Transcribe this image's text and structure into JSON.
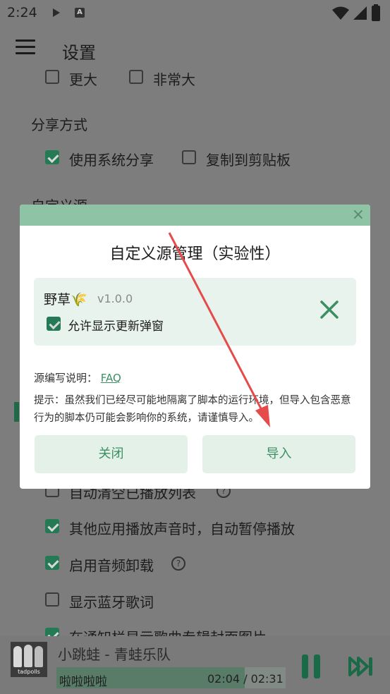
{
  "status_bar": {
    "time": "2:24"
  },
  "app_bar": {
    "title": "设置"
  },
  "settings": {
    "font_size_options": [
      {
        "label": "更大",
        "checked": false
      },
      {
        "label": "非常大",
        "checked": false
      }
    ],
    "share_section": {
      "title": "分享方式"
    },
    "share_options": [
      {
        "label": "使用系统分享",
        "checked": true
      },
      {
        "label": "复制到剪贴板",
        "checked": false
      }
    ],
    "custom_source_section": {
      "title": "自定义源"
    },
    "playback_options": [
      {
        "label": "自动清空已播放列表",
        "checked": false,
        "help": "?"
      },
      {
        "label": "其他应用播放声音时，自动暂停播放",
        "checked": true
      },
      {
        "label": "启用音频卸载",
        "checked": true,
        "help": "?"
      },
      {
        "label": "显示蓝牙歌词",
        "checked": false
      },
      {
        "label": "在通知栏显示歌曲专辑封面图片",
        "checked": true
      }
    ]
  },
  "dialog": {
    "close_glyph": "×",
    "title": "自定义源管理（实验性）",
    "source": {
      "name": "野草🌾",
      "version": "v1.0.0",
      "allow_update_popup_label": "允许显示更新弹窗",
      "allow_update_popup_checked": true
    },
    "doc_label": "源编写说明：",
    "doc_link": "FAQ",
    "tip": "提示：虽然我们已经尽可能地隔离了脚本的运行环境，但导入包含恶意行为的脚本仍可能会影响你的系统，请谨慎导入。",
    "close_button": "关闭",
    "import_button": "导入"
  },
  "player": {
    "song": "小跳蛙 - 青蛙乐队",
    "lyric": "啦啦啦啦",
    "time": "02:04 / 02:31",
    "progress": 0.82,
    "album_caption": "tadpolls"
  },
  "colors": {
    "accent": "#3c8f63",
    "dialog_header": "#8ec3a5",
    "arrow": "#e64b4b"
  }
}
